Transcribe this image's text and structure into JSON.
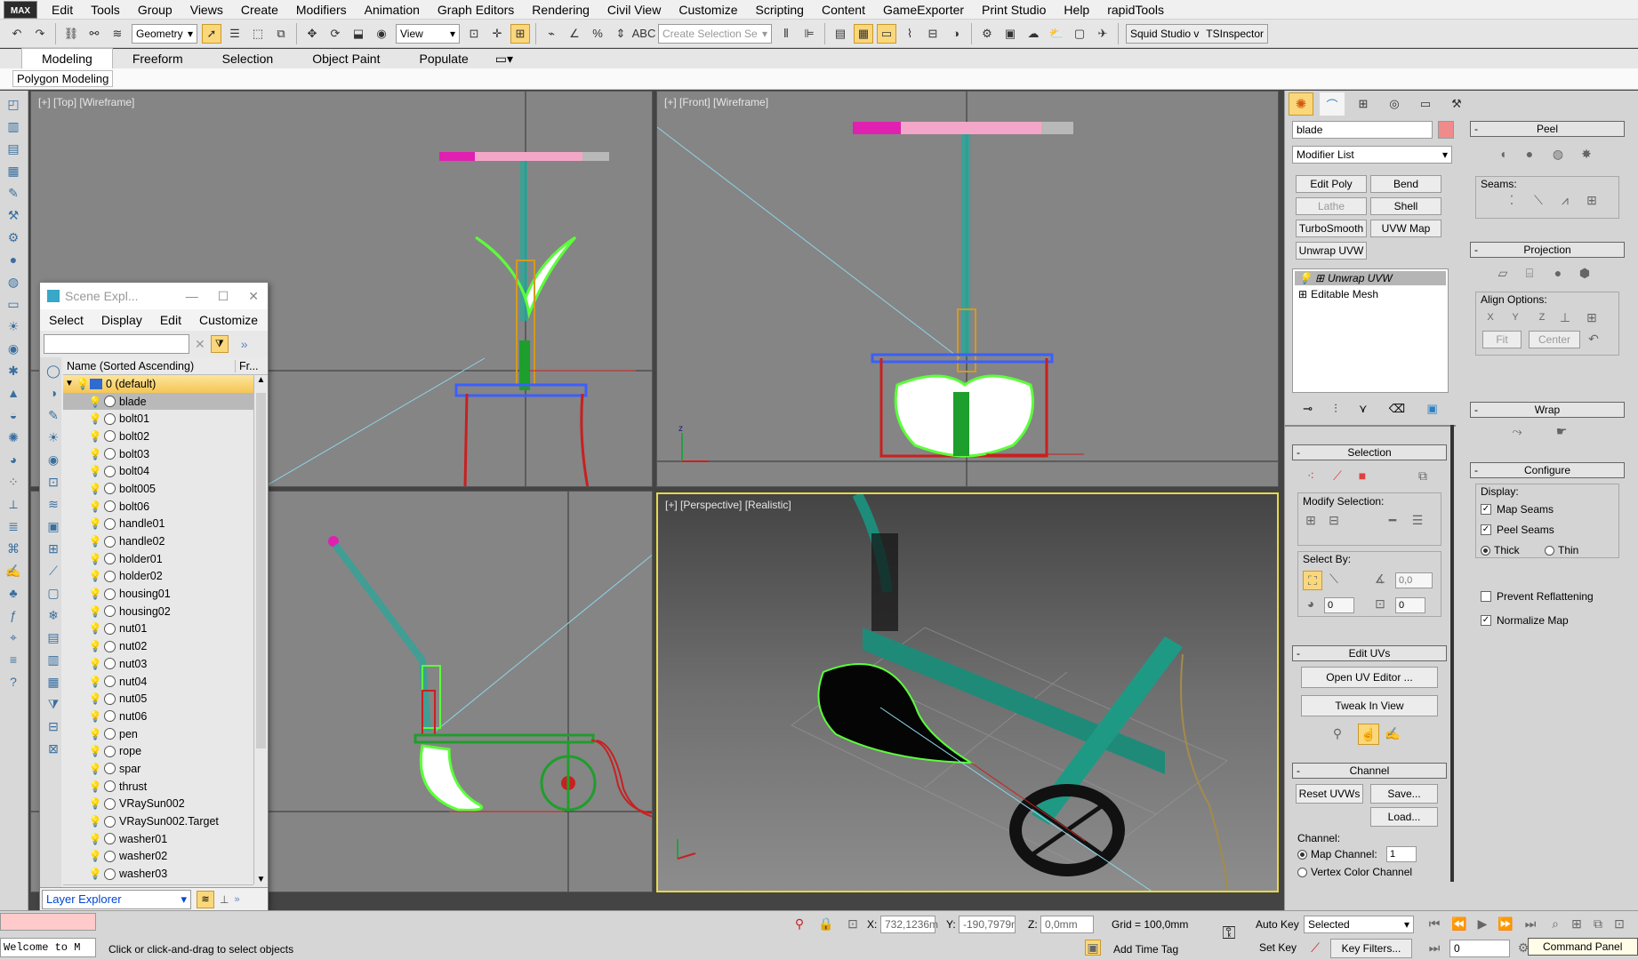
{
  "app": {
    "logo": "MAX"
  },
  "menu": [
    "Edit",
    "Tools",
    "Group",
    "Views",
    "Create",
    "Modifiers",
    "Animation",
    "Graph Editors",
    "Rendering",
    "Civil View",
    "Customize",
    "Scripting",
    "Content",
    "GameExporter",
    "Print Studio",
    "Help",
    "rapidTools"
  ],
  "toolbar": {
    "selection_filter": "Geometry",
    "ref_coord": "View",
    "named_selection_placeholder": "Create Selection Se",
    "workspace": "Squid Studio v",
    "inspector": "TSInspector"
  },
  "ribbon": {
    "tabs": [
      "Modeling",
      "Freeform",
      "Selection",
      "Object Paint",
      "Populate"
    ],
    "active": "Modeling",
    "sub": "Polygon Modeling"
  },
  "viewports": {
    "top": "[+] [Top] [Wireframe]",
    "front": "[+] [Front] [Wireframe]",
    "left": "",
    "perspective": "[+] [Perspective] [Realistic]"
  },
  "scene_explorer": {
    "title": "Scene Expl...",
    "menu": [
      "Select",
      "Display",
      "Edit",
      "Customize"
    ],
    "col_name": "Name (Sorted Ascending)",
    "col_fr": "Fr...",
    "layer": "0 (default)",
    "items": [
      "blade",
      "bolt01",
      "bolt02",
      "bolt03",
      "bolt04",
      "bolt005",
      "bolt06",
      "handle01",
      "handle02",
      "holder01",
      "holder02",
      "housing01",
      "housing02",
      "nut01",
      "nut02",
      "nut03",
      "nut04",
      "nut05",
      "nut06",
      "pen",
      "rope",
      "spar",
      "thrust",
      "VRaySun002",
      "VRaySun002.Target",
      "washer01",
      "washer02",
      "washer03"
    ],
    "selected": "blade",
    "footer": "Layer Explorer"
  },
  "command_panel": {
    "object_name": "blade",
    "modifier_list": "Modifier List",
    "mod_buttons": [
      "Edit Poly",
      "Bend",
      "Lathe",
      "Shell",
      "TurboSmooth",
      "UVW Map",
      "Unwrap UVW"
    ],
    "stack": [
      "Unwrap UVW",
      "Editable Mesh"
    ],
    "selection": {
      "title": "Selection",
      "modify_label": "Modify Selection:",
      "select_by": "Select By:",
      "angle": "0,0",
      "v1": "0",
      "v2": "0"
    },
    "edit_uvs": {
      "title": "Edit UVs",
      "open": "Open UV Editor ...",
      "tweak": "Tweak In View"
    },
    "channel": {
      "title": "Channel",
      "reset": "Reset UVWs",
      "save": "Save...",
      "load": "Load...",
      "label": "Channel:",
      "map": "Map Channel:",
      "map_value": "1",
      "vertex": "Vertex Color Channel"
    },
    "peel": {
      "title": "Peel",
      "seams": "Seams:"
    },
    "projection": {
      "title": "Projection",
      "align": "Align Options:",
      "fit": "Fit",
      "center": "Center"
    },
    "wrap": {
      "title": "Wrap"
    },
    "configure": {
      "title": "Configure",
      "display": "Display:",
      "map_seams": "Map Seams",
      "peel_seams": "Peel Seams",
      "thick": "Thick",
      "thin": "Thin",
      "prevent": "Prevent Reflattening",
      "normalize": "Normalize Map"
    }
  },
  "status": {
    "listener": "Welcome to M",
    "prompt": "Click or click-and-drag to select objects",
    "x_label": "X:",
    "x": "732,1236m",
    "y_label": "Y:",
    "y": "-190,7979r",
    "z_label": "Z:",
    "z": "0,0mm",
    "grid": "Grid = 100,0mm",
    "add_time_tag": "Add Time Tag",
    "auto_key": "Auto Key",
    "set_key": "Set Key",
    "selected": "Selected",
    "key_filters": "Key Filters...",
    "frame": "0",
    "tooltip": "Command Panel"
  }
}
